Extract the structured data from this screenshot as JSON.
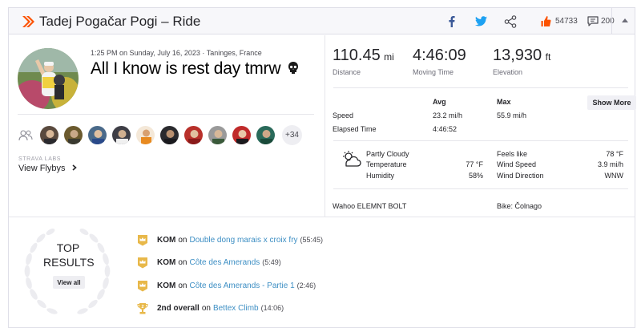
{
  "header": {
    "title": "Tadej Pogačar Pogi – Ride",
    "kudos_count": "54733",
    "comment_count": "200"
  },
  "activity": {
    "datetime_location": "1:25 PM on Sunday, July 16, 2023 · Taninges, France",
    "title": "All I know is rest day tmrw",
    "title_emoji": "skull-emoji"
  },
  "athletes": {
    "more_count": "+34",
    "avatar_colors": [
      "#5a4a3e",
      "#6b5a2e",
      "#4a6a8a",
      "#3e3e46",
      "#c8a040",
      "#2a2a2e",
      "#b8302a",
      "#9a9a9a",
      "#c02a2a",
      "#2a6a5a"
    ]
  },
  "flybys": {
    "labs_label": "STRAVA LABS",
    "link_label": "View Flybys"
  },
  "stats": {
    "distance": {
      "value": "110.45",
      "unit": "mi",
      "label": "Distance"
    },
    "moving_time": {
      "value": "4:46:09",
      "label": "Moving Time"
    },
    "elevation": {
      "value": "13,930",
      "unit": "ft",
      "label": "Elevation"
    }
  },
  "table": {
    "col_avg": "Avg",
    "col_max": "Max",
    "show_more": "Show More",
    "rows": [
      {
        "label": "Speed",
        "avg": "23.2 mi/h",
        "max": "55.9 mi/h"
      },
      {
        "label": "Elapsed Time",
        "avg": "4:46:52",
        "max": ""
      }
    ]
  },
  "weather": {
    "condition": "Partly Cloudy",
    "temperature_label": "Temperature",
    "temperature": "77 °F",
    "humidity_label": "Humidity",
    "humidity": "58%",
    "feels_like_label": "Feels like",
    "feels_like": "78 °F",
    "wind_speed_label": "Wind Speed",
    "wind_speed": "3.9 mi/h",
    "wind_direction_label": "Wind Direction",
    "wind_direction": "WNW"
  },
  "device": "Wahoo ELEMNT BOLT",
  "bike": "Bike: Čolnago",
  "top_results": {
    "title_line1": "TOP",
    "title_line2": "RESULTS",
    "view_all": "View all",
    "items": [
      {
        "kind": "KOM",
        "on": "on",
        "segment": "Double dong marais x croix fry",
        "time": "(55:45)",
        "icon": "kom-crown-icon"
      },
      {
        "kind": "KOM",
        "on": "on",
        "segment": "Côte des Amerands",
        "time": "(5:49)",
        "icon": "kom-crown-icon"
      },
      {
        "kind": "KOM",
        "on": "on",
        "segment": "Côte des Amerands - Partie 1",
        "time": "(2:46)",
        "icon": "kom-crown-icon"
      },
      {
        "kind": "2nd overall",
        "on": "on",
        "segment": "Bettex Climb",
        "time": "(14:06)",
        "icon": "trophy-2-icon"
      }
    ]
  },
  "colors": {
    "brand": "#fc5200",
    "link": "#3e8fc4",
    "facebook": "#3b5998",
    "twitter": "#1da1f2",
    "badge_gold": "#e8b84a"
  },
  "icons": [
    "strava-logo-icon",
    "facebook-icon",
    "twitter-icon",
    "share-icon",
    "kudos-icon",
    "comment-icon",
    "collapse-caret-icon",
    "group-icon",
    "chevron-right-icon",
    "partly-cloudy-icon",
    "laurel-icon"
  ]
}
